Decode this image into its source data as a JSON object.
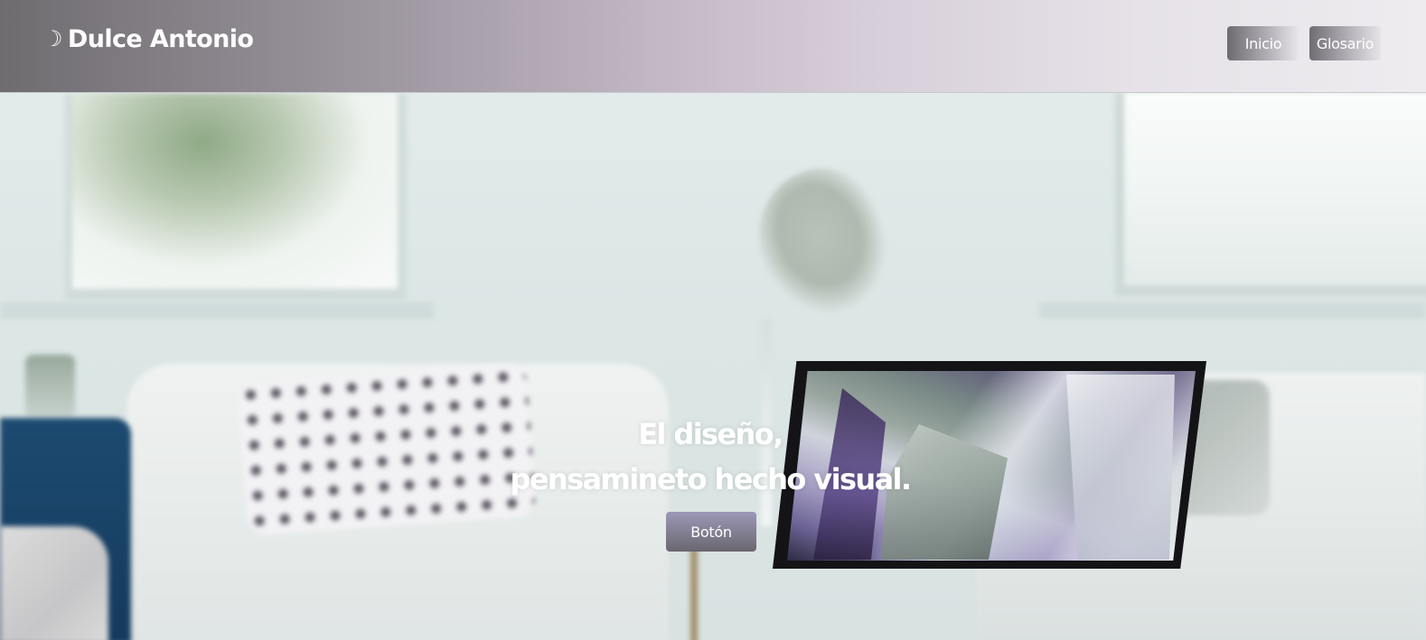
{
  "header": {
    "brand_icon": "☽",
    "brand_name": "Dulce Antonio",
    "nav": [
      {
        "label": "Inicio"
      },
      {
        "label": "Glosario"
      }
    ]
  },
  "hero": {
    "title_line_1": "El diseño,",
    "title_line_2": "pensamineto hecho visual.",
    "button_label": "Botón",
    "background_image": "living-room-with-laptop"
  },
  "colors": {
    "header_gradient_start": "#6f6c70",
    "header_gradient_mid": "#d6cdd8",
    "header_gradient_end": "#eeecef",
    "hero_button": "#7e7b8c",
    "text_light": "#ffffff"
  }
}
